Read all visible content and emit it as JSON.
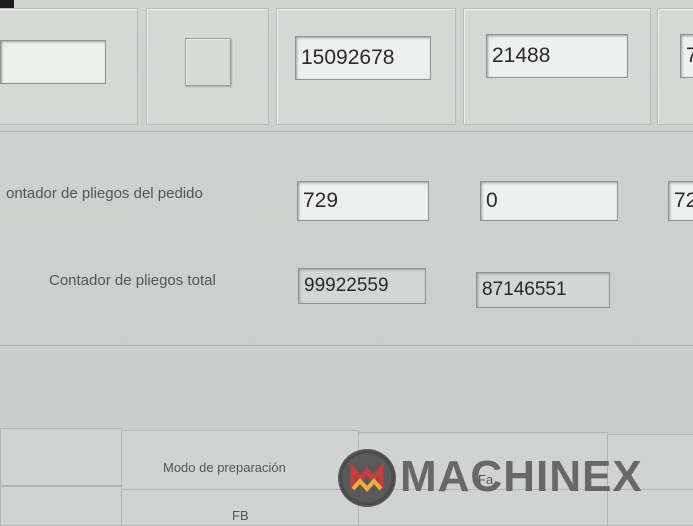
{
  "top_row": {
    "field_1_value": "",
    "field_2_value": "15092678",
    "field_3_value": "21488",
    "field_4_value": "7"
  },
  "order_counter": {
    "label": "ontador de pliegos del pedido",
    "value_1": "729",
    "value_2": "0",
    "value_3": "72"
  },
  "total_counter": {
    "label": "Contador de pliegos total",
    "value_1": "99922559",
    "value_2": "87146551"
  },
  "bottom_grid": {
    "mode_label": "Modo de preparación",
    "cell_fa": "Fa",
    "cell_fb": "FB"
  },
  "watermark": {
    "text": "MACHINEX",
    "badge_colors": [
      "#c62828",
      "#f9a825"
    ]
  }
}
